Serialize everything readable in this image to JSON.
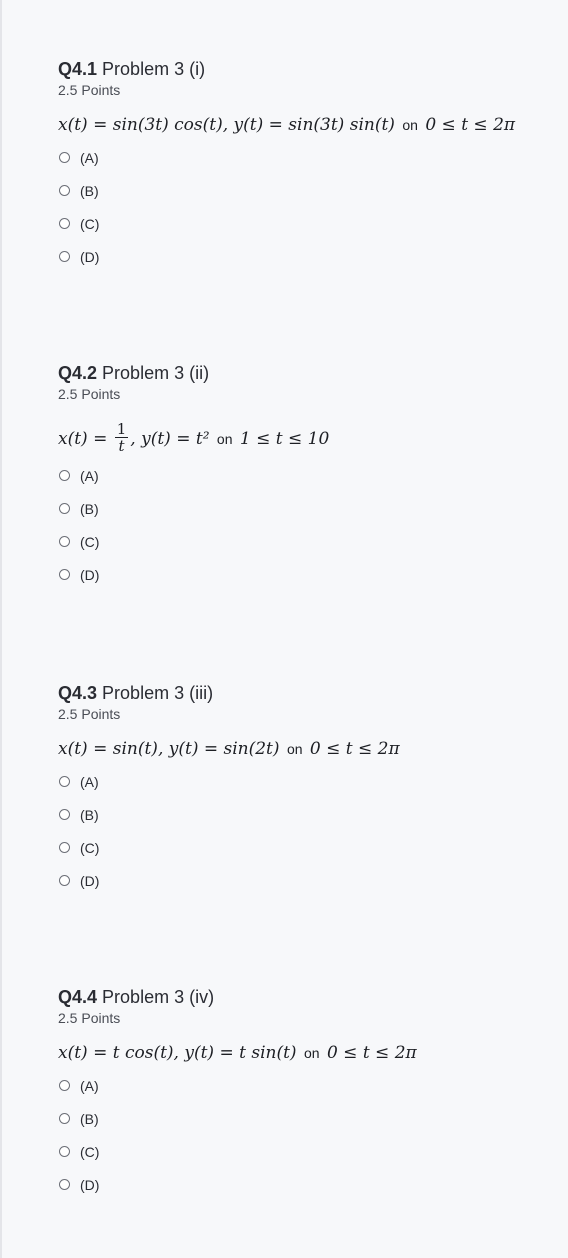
{
  "questions": [
    {
      "number": "Q4.1",
      "name": "Problem 3 (i)",
      "points": "2.5 Points",
      "formula": {
        "x_expr": "x(t) = sin(3t) cos(t), y(t) = sin(3t) sin(t)",
        "on": "on",
        "range": "0 ≤ t ≤ 2π"
      },
      "options": [
        "(A)",
        "(B)",
        "(C)",
        "(D)"
      ]
    },
    {
      "number": "Q4.2",
      "name": "Problem 3 (ii)",
      "points": "2.5 Points",
      "formula": {
        "x_lhs": "x(t) =",
        "frac_num": "1",
        "frac_den": "t",
        "rest": ", y(t) = t²",
        "on": "on",
        "range": "1 ≤ t ≤ 10"
      },
      "options": [
        "(A)",
        "(B)",
        "(C)",
        "(D)"
      ]
    },
    {
      "number": "Q4.3",
      "name": "Problem 3 (iii)",
      "points": "2.5 Points",
      "formula": {
        "x_expr": "x(t) = sin(t), y(t) = sin(2t)",
        "on": "on",
        "range": "0 ≤ t ≤ 2π"
      },
      "options": [
        "(A)",
        "(B)",
        "(C)",
        "(D)"
      ]
    },
    {
      "number": "Q4.4",
      "name": "Problem 3 (iv)",
      "points": "2.5 Points",
      "formula": {
        "x_expr": "x(t) = t cos(t), y(t) = t sin(t)",
        "on": "on",
        "range": "0 ≤ t ≤ 2π"
      },
      "options": [
        "(A)",
        "(B)",
        "(C)",
        "(D)"
      ]
    }
  ]
}
